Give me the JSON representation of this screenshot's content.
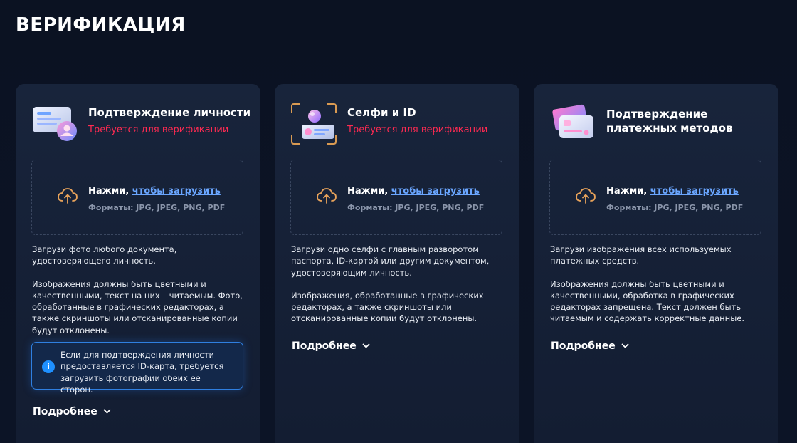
{
  "page": {
    "title": "ВЕРИФИКАЦИЯ"
  },
  "cards": [
    {
      "title": "Подтверждение личности",
      "subtitle": "Требуется для верификации",
      "upload": {
        "prefix": "Нажми, ",
        "link": "чтобы загрузить",
        "formats": "Форматы: JPG, JPEG, PNG, PDF"
      },
      "desc1": "Загрузи фото любого документа, удостоверяющего личность.",
      "desc2": "Изображения должны быть цветными и качественными, текст на них – читаемым. Фото, обработанные в графических редакторах, а также скриншоты или отсканированные копии будут отклонены.",
      "notice": "Если для подтверждения личности предоставляется ID-карта, требуется загрузить фотографии обеих ее сторон.",
      "more": "Подробнее",
      "icon": "id-document-icon"
    },
    {
      "title": "Селфи и ID",
      "subtitle": "Требуется для верификации",
      "upload": {
        "prefix": "Нажми, ",
        "link": "чтобы загрузить",
        "formats": "Форматы: JPG, JPEG, PNG, PDF"
      },
      "desc1": "Загрузи одно селфи с главным разворотом паспорта, ID-картой или другим документом, удостоверяющим личность.",
      "desc2": "Изображения, обработанные в графических редакторах, а также скриншоты или отсканированные копии будут отклонены.",
      "more": "Подробнее",
      "icon": "selfie-id-icon"
    },
    {
      "title": "Подтверждение платежных методов",
      "subtitle": "",
      "upload": {
        "prefix": "Нажми, ",
        "link": "чтобы загрузить",
        "formats": "Форматы: JPG, JPEG, PNG, PDF"
      },
      "desc1": "Загрузи изображения всех используемых платежных средств.",
      "desc2": "Изображения должны быть цветными и качественными, обработка в графических редакторах запрещена. Текст должен быть читаемым и содержать корректные данные.",
      "more": "Подробнее",
      "icon": "payment-cards-icon"
    }
  ],
  "colors": {
    "accent_red": "#ff2a52",
    "link_blue": "#6aa6ff",
    "upload_orange": "#e8a35a",
    "info_blue": "#1e90ff"
  }
}
